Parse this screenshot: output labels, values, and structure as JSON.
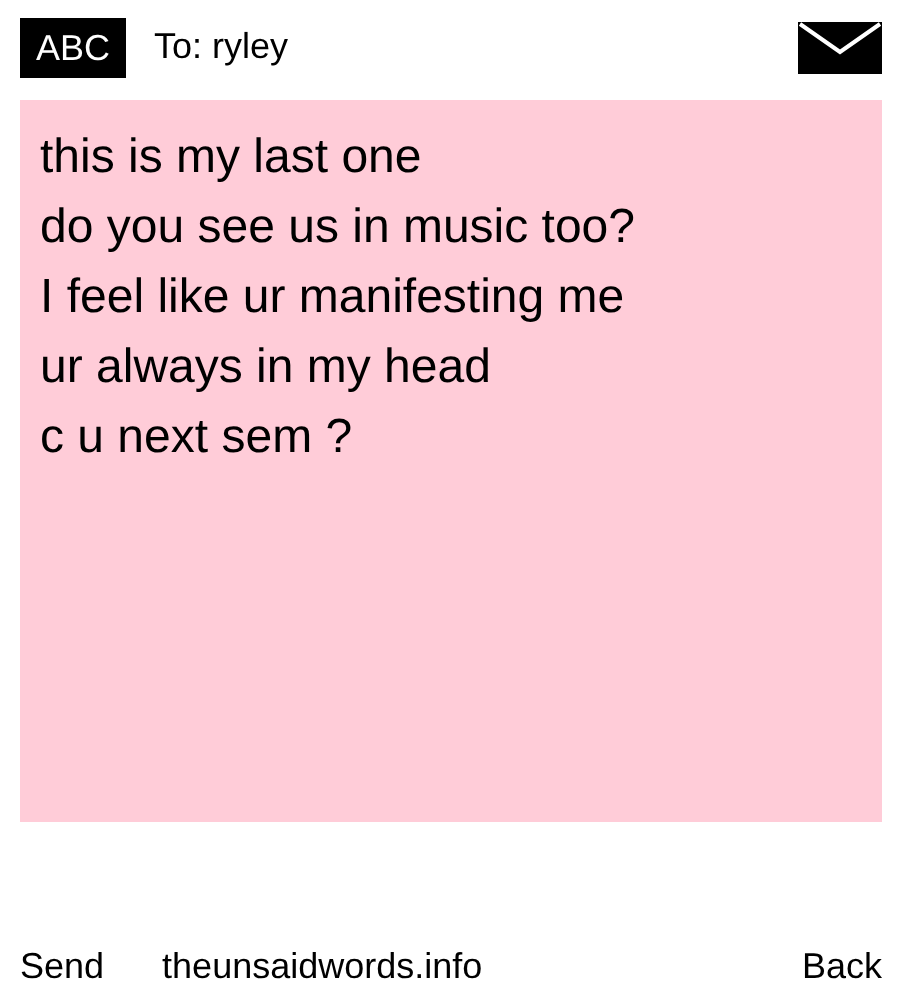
{
  "header": {
    "mode": "ABC",
    "recipient": "To: ryley"
  },
  "message": {
    "lines": [
      "this is my last one",
      "do you see us in music too?",
      "I feel like ur manifesting me",
      "ur always in my head",
      "c u next sem ?"
    ]
  },
  "footer": {
    "send": "Send",
    "site": "theunsaidwords.info",
    "back": "Back"
  }
}
